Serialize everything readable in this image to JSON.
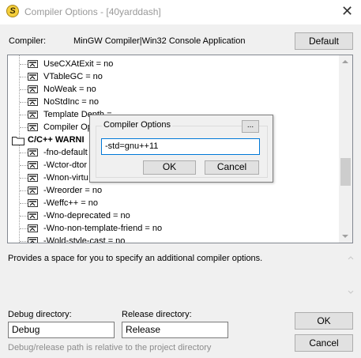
{
  "window": {
    "title": "Compiler Options - [40yarddash]",
    "app_icon": "sigma-icon",
    "close_glyph": "✕"
  },
  "compiler": {
    "label": "Compiler:",
    "value": "MinGW Compiler|Win32 Console Application",
    "default_button": "Default"
  },
  "tree": {
    "rows": [
      {
        "label": "UseCXAtExit = no",
        "kind": "option"
      },
      {
        "label": "VTableGC = no",
        "kind": "option"
      },
      {
        "label": "NoWeak = no",
        "kind": "option"
      },
      {
        "label": "NoStdInc = no",
        "kind": "option"
      },
      {
        "label": "Template Depth =",
        "kind": "option"
      },
      {
        "label": "Compiler Op",
        "kind": "option"
      },
      {
        "label": "C/C++ WARNI",
        "kind": "folder"
      },
      {
        "label": "-fno-default",
        "kind": "option"
      },
      {
        "label": "-Wctor-dtor",
        "kind": "option"
      },
      {
        "label": "-Wnon-virtu",
        "kind": "option"
      },
      {
        "label": "-Wreorder = no",
        "kind": "option"
      },
      {
        "label": "-Weffc++ = no",
        "kind": "option"
      },
      {
        "label": "-Wno-deprecated = no",
        "kind": "option"
      },
      {
        "label": "-Wno-non-template-friend = no",
        "kind": "option"
      },
      {
        "label": "-Wold-style-cast = no",
        "kind": "option"
      }
    ]
  },
  "description": "Provides a space for you to specify an additional compiler options.",
  "debug": {
    "label": "Debug directory:",
    "value": "Debug"
  },
  "release": {
    "label": "Release directory:",
    "value": "Release"
  },
  "hint": "Debug/release path is relative to the project directory",
  "buttons": {
    "ok": "OK",
    "cancel": "Cancel"
  },
  "popup": {
    "group_title": "Compiler Options",
    "ellipsis_button": "...",
    "input_value": "-std=gnu++11",
    "ok": "OK",
    "cancel": "Cancel"
  },
  "colors": {
    "focus_border": "#0078d7",
    "title_text": "#999999"
  }
}
